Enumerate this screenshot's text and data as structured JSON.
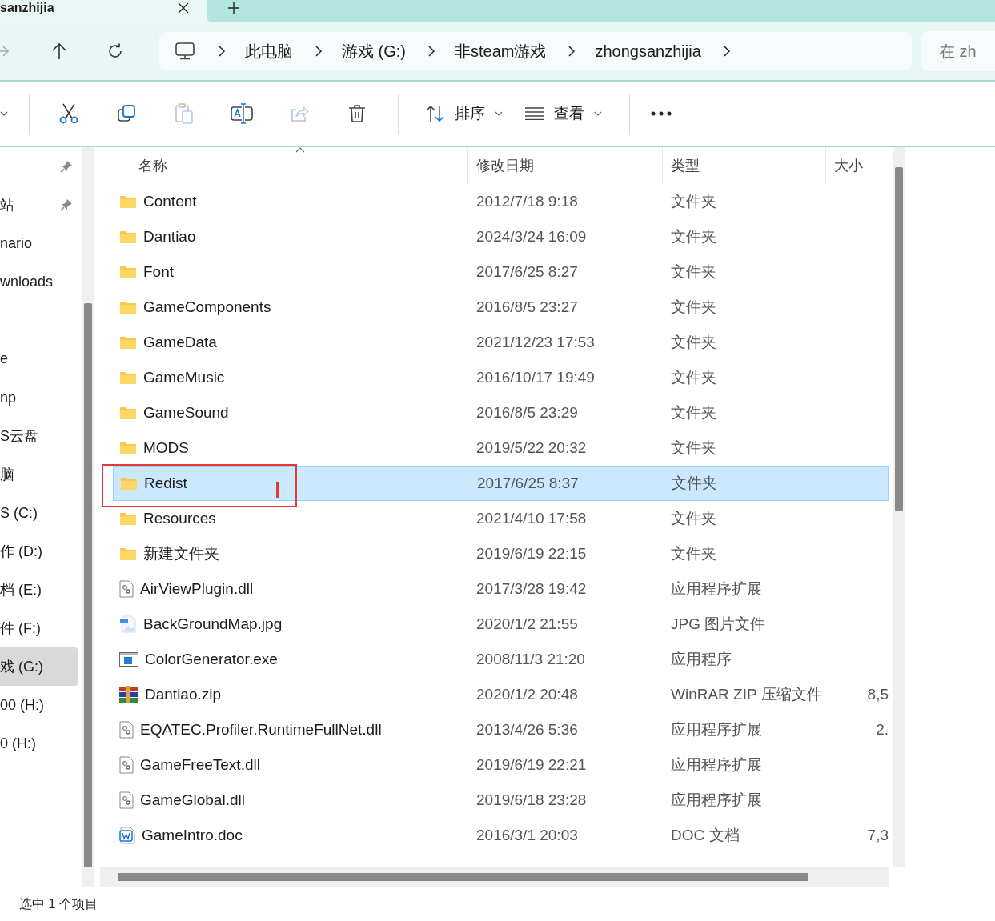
{
  "tab": {
    "title": "sanzhijia"
  },
  "breadcrumbs": [
    "此电脑",
    "游戏 (G:)",
    "非steam游戏",
    "zhongsanzhijia"
  ],
  "search": {
    "placeholder": "在 zh"
  },
  "toolbar": [
    {
      "kind": "cut",
      "disabled": false
    },
    {
      "kind": "copy",
      "disabled": false
    },
    {
      "kind": "paste",
      "disabled": true
    },
    {
      "kind": "rename",
      "disabled": false
    },
    {
      "kind": "share",
      "disabled": true
    },
    {
      "kind": "delete",
      "disabled": false
    }
  ],
  "sort_button": {
    "label": "排序"
  },
  "view_button": {
    "label": "查看"
  },
  "sidebar": {
    "quick_access": [
      {
        "pinned": true,
        "selected": false
      },
      {
        "label": "站",
        "pinned": true,
        "selected": false
      },
      {
        "label": "nario",
        "pinned": false,
        "selected": false
      },
      {
        "label": "wnloads",
        "pinned": false,
        "selected": false
      },
      {
        "label": "e",
        "pinned": false,
        "selected": false
      }
    ],
    "items": [
      {
        "label": "np",
        "pinned": false,
        "selected": false
      },
      {
        "label": "S云盘",
        "pinned": false,
        "selected": false
      },
      {
        "label": "脑",
        "pinned": false,
        "selected": false
      },
      {
        "label": "S (C:)",
        "pinned": false,
        "selected": false
      },
      {
        "label": "作 (D:)",
        "pinned": false,
        "selected": false
      },
      {
        "label": "档 (E:)",
        "pinned": false,
        "selected": false
      },
      {
        "label": "件 (F:)",
        "pinned": false,
        "selected": false
      },
      {
        "label": "戏 (G:)",
        "pinned": false,
        "selected": true
      },
      {
        "label": "00 (H:)",
        "pinned": false,
        "selected": false
      },
      {
        "label": "0 (H:)",
        "pinned": false,
        "selected": false
      }
    ]
  },
  "table": {
    "columns": [
      "名称",
      "修改日期",
      "类型",
      "大小"
    ],
    "rows": [
      {
        "kind": "folder",
        "name": "Content",
        "date": "2012/7/18 9:18",
        "type": "文件夹",
        "selected": false
      },
      {
        "kind": "folder",
        "name": "Dantiao",
        "date": "2024/3/24 16:09",
        "type": "文件夹",
        "selected": false
      },
      {
        "kind": "folder",
        "name": "Font",
        "date": "2017/6/25 8:27",
        "type": "文件夹",
        "selected": false
      },
      {
        "kind": "folder",
        "name": "GameComponents",
        "date": "2016/8/5 23:27",
        "type": "文件夹",
        "selected": false
      },
      {
        "kind": "folder",
        "name": "GameData",
        "date": "2021/12/23 17:53",
        "type": "文件夹",
        "selected": false
      },
      {
        "kind": "folder",
        "name": "GameMusic",
        "date": "2016/10/17 19:49",
        "type": "文件夹",
        "selected": false
      },
      {
        "kind": "folder",
        "name": "GameSound",
        "date": "2016/8/5 23:29",
        "type": "文件夹",
        "selected": false
      },
      {
        "kind": "folder",
        "name": "MODS",
        "date": "2019/5/22 20:32",
        "type": "文件夹",
        "selected": false
      },
      {
        "kind": "folder",
        "name": "Redist",
        "date": "2017/6/25 8:37",
        "type": "文件夹",
        "selected": true,
        "highlighted": true
      },
      {
        "kind": "folder",
        "name": "Resources",
        "date": "2021/4/10 17:58",
        "type": "文件夹",
        "selected": false
      },
      {
        "kind": "folder",
        "name": "新建文件夹",
        "date": "2019/6/19 22:15",
        "type": "文件夹",
        "selected": false
      },
      {
        "kind": "dll",
        "name": "AirViewPlugin.dll",
        "date": "2017/3/28 19:42",
        "type": "应用程序扩展",
        "selected": false
      },
      {
        "kind": "image",
        "name": "BackGroundMap.jpg",
        "date": "2020/1/2 21:55",
        "type": "JPG 图片文件",
        "selected": false
      },
      {
        "kind": "exe",
        "name": "ColorGenerator.exe",
        "date": "2008/11/3 21:20",
        "type": "应用程序",
        "selected": false
      },
      {
        "kind": "archive",
        "name": "Dantiao.zip",
        "date": "2020/1/2 20:48",
        "type": "WinRAR ZIP 压缩文件",
        "size": "8,5",
        "selected": false
      },
      {
        "kind": "dll",
        "name": "EQATEC.Profiler.RuntimeFullNet.dll",
        "date": "2013/4/26 5:36",
        "type": "应用程序扩展",
        "size": "2.",
        "selected": false
      },
      {
        "kind": "dll",
        "name": "GameFreeText.dll",
        "date": "2019/6/19 22:21",
        "type": "应用程序扩展",
        "selected": false
      },
      {
        "kind": "dll",
        "name": "GameGlobal.dll",
        "date": "2019/6/18 23:28",
        "type": "应用程序扩展",
        "selected": false
      },
      {
        "kind": "document",
        "name": "GameIntro.doc",
        "date": "2016/3/1 20:03",
        "type": "DOC 文档",
        "size": "7,3",
        "selected": false
      }
    ]
  },
  "status_bar": {
    "text": "选中 1 个项目"
  }
}
